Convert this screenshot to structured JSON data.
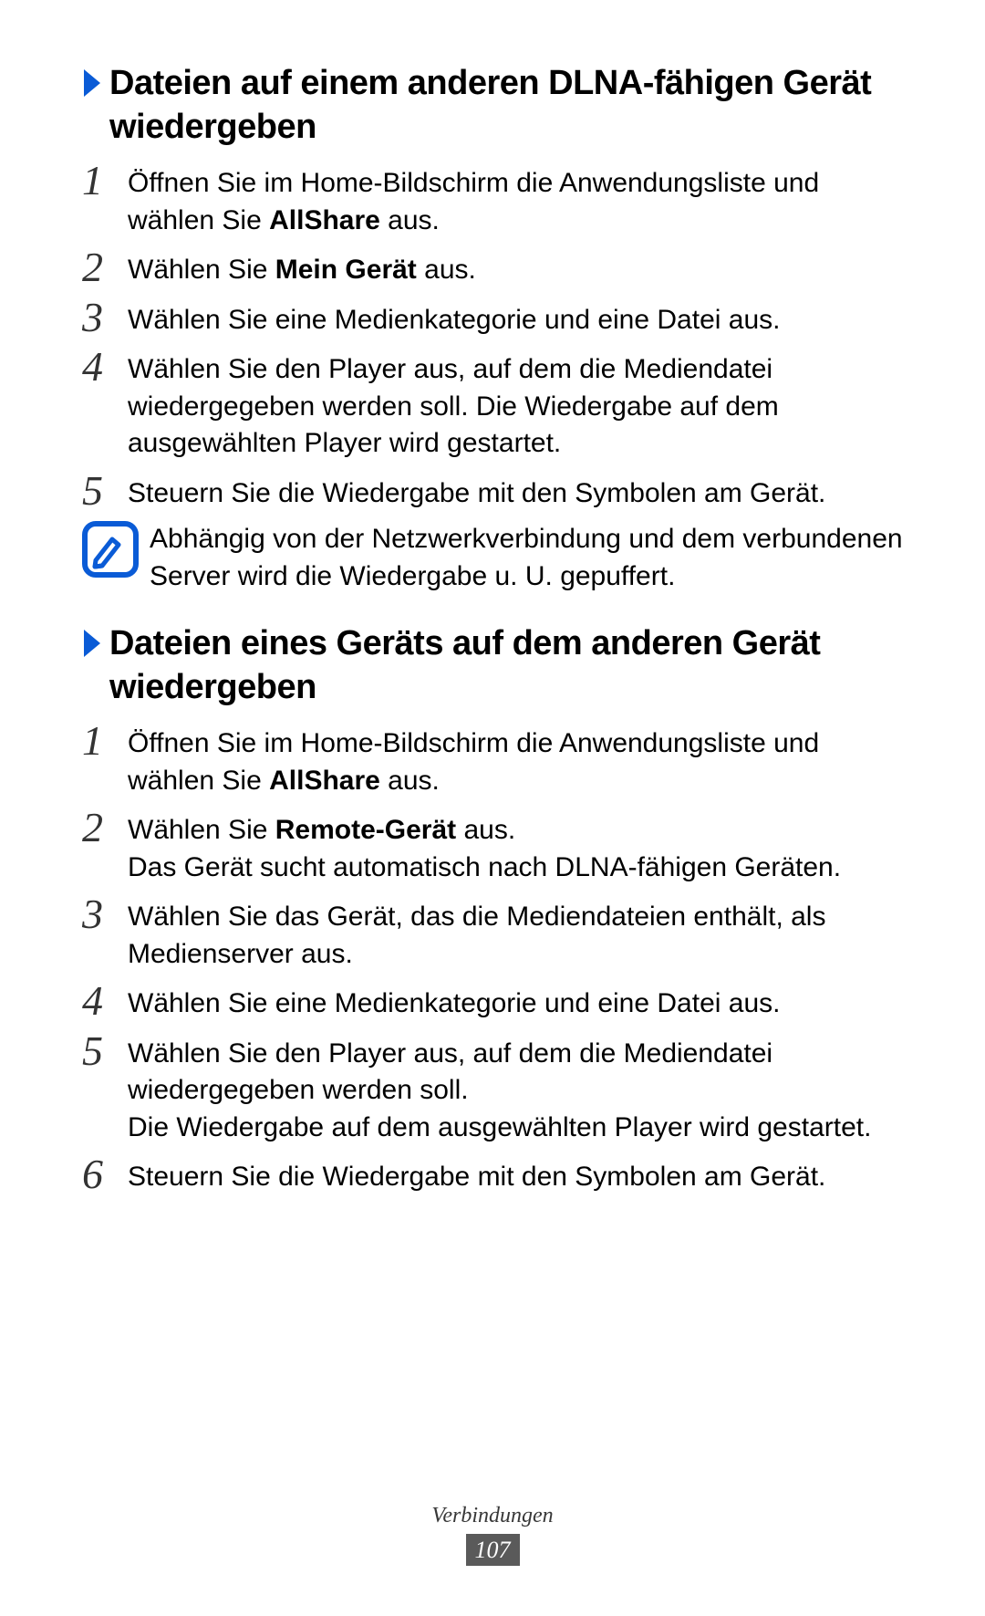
{
  "section1": {
    "heading": "Dateien auf einem anderen DLNA-fähigen Gerät wiedergeben",
    "steps": [
      {
        "num": "1",
        "parts": [
          {
            "t": "Öffnen Sie im Home-Bildschirm die Anwendungsliste und wählen Sie "
          },
          {
            "t": "AllShare",
            "bold": true
          },
          {
            "t": " aus."
          }
        ]
      },
      {
        "num": "2",
        "parts": [
          {
            "t": "Wählen Sie "
          },
          {
            "t": "Mein Gerät",
            "bold": true
          },
          {
            "t": " aus."
          }
        ]
      },
      {
        "num": "3",
        "parts": [
          {
            "t": "Wählen Sie eine Medienkategorie und eine Datei aus."
          }
        ]
      },
      {
        "num": "4",
        "parts": [
          {
            "t": "Wählen Sie den Player aus, auf dem die Mediendatei wiedergegeben werden soll. Die Wiedergabe auf dem ausgewählten Player wird gestartet."
          }
        ]
      },
      {
        "num": "5",
        "parts": [
          {
            "t": "Steuern Sie die Wiedergabe mit den Symbolen am Gerät."
          }
        ]
      }
    ],
    "note": "Abhängig von der Netzwerkverbindung und dem verbundenen Server wird die Wiedergabe u. U. gepuffert."
  },
  "section2": {
    "heading": "Dateien eines Geräts auf dem anderen Gerät wiedergeben",
    "steps": [
      {
        "num": "1",
        "parts": [
          {
            "t": "Öffnen Sie im Home-Bildschirm die Anwendungsliste und wählen Sie "
          },
          {
            "t": "AllShare",
            "bold": true
          },
          {
            "t": " aus."
          }
        ]
      },
      {
        "num": "2",
        "parts": [
          {
            "t": "Wählen Sie "
          },
          {
            "t": "Remote-Gerät",
            "bold": true
          },
          {
            "t": " aus."
          },
          {
            "t": "\nDas Gerät sucht automatisch nach DLNA-fähigen Geräten."
          }
        ]
      },
      {
        "num": "3",
        "parts": [
          {
            "t": "Wählen Sie das Gerät, das die Mediendateien enthält, als Medienserver aus."
          }
        ]
      },
      {
        "num": "4",
        "parts": [
          {
            "t": "Wählen Sie eine Medienkategorie und eine Datei aus."
          }
        ]
      },
      {
        "num": "5",
        "parts": [
          {
            "t": "Wählen Sie den Player aus, auf dem die Mediendatei wiedergegeben werden soll."
          },
          {
            "t": "\nDie Wiedergabe auf dem ausgewählten Player wird gestartet."
          }
        ]
      },
      {
        "num": "6",
        "parts": [
          {
            "t": "Steuern Sie die Wiedergabe mit den Symbolen am Gerät."
          }
        ]
      }
    ]
  },
  "footer": {
    "label": "Verbindungen",
    "page": "107"
  }
}
